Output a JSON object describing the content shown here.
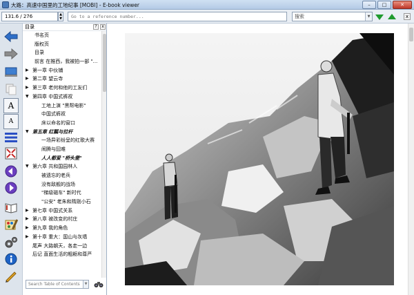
{
  "window": {
    "title": "大路：高速中国里的工地纪事 [MOBI] - E-book viewer",
    "minimize_glyph": "–",
    "maximize_glyph": "□",
    "close_glyph": "✕"
  },
  "toolbar": {
    "position_value": "131.6 / 276",
    "reference_placeholder": "Go to a reference number...",
    "search_placeholder": "搜索",
    "dropdown_glyph": "▼",
    "spin_up": "▲",
    "spin_down": "▼",
    "close_glyph": "x",
    "colors": {
      "nav_arrow": "#1f9a2e"
    }
  },
  "sidebar": {
    "icons": [
      "back-icon",
      "forward-icon",
      "library-icon",
      "copy-icon",
      "font-larger-icon",
      "font-smaller-icon",
      "toc-icon",
      "fullscreen-icon",
      "previous-page-icon",
      "next-page-icon",
      "reference-mode-icon",
      "theme-icon",
      "preferences-icon",
      "info-icon",
      "print-icon"
    ],
    "font_larger_label": "A",
    "font_smaller_label": "A"
  },
  "toc": {
    "header": "目录",
    "header_btn_1": "?",
    "header_btn_2": "x",
    "items": [
      {
        "label": "书名页",
        "indent": 2,
        "arrow": ""
      },
      {
        "label": "版权页",
        "indent": 2,
        "arrow": ""
      },
      {
        "label": "目录",
        "indent": 2,
        "arrow": ""
      },
      {
        "label": "前言 在推西，我被拍一部 \"...",
        "indent": 2,
        "arrow": ""
      },
      {
        "label": "第一章 中伙铺",
        "indent": 1,
        "arrow": "▶"
      },
      {
        "label": "第二章 望云寺",
        "indent": 1,
        "arrow": "▶"
      },
      {
        "label": "第三章 老何和他的工友们",
        "indent": 1,
        "arrow": "▶"
      },
      {
        "label": "第四章 中国式裤衩",
        "indent": 1,
        "arrow": "▼"
      },
      {
        "label": "工地上演 \"黑帮电影\"",
        "indent": 3,
        "arrow": ""
      },
      {
        "label": "中国式裤衩",
        "indent": 3,
        "arrow": ""
      },
      {
        "label": "床以命名的窗口",
        "indent": 3,
        "arrow": ""
      },
      {
        "label": "第五章 红瓢与拉杆",
        "indent": 1,
        "arrow": "▼",
        "bold": true
      },
      {
        "label": "一场异彩纷呈的红歌大赛",
        "indent": 3,
        "arrow": ""
      },
      {
        "label": "闹腾与囧难",
        "indent": 3,
        "arrow": ""
      },
      {
        "label": "人人都爱 \"桥头堡\"",
        "indent": 3,
        "arrow": "",
        "bold": true
      },
      {
        "label": "第六章 共和国园林人",
        "indent": 1,
        "arrow": "▼"
      },
      {
        "label": "被遗忘的老兵",
        "indent": 3,
        "arrow": ""
      },
      {
        "label": "没有敌舰的战场",
        "indent": 3,
        "arrow": ""
      },
      {
        "label": "\"梯级磁车\" 新时代",
        "indent": 3,
        "arrow": ""
      },
      {
        "label": "\"公安\" 老朱和隋刚小石",
        "indent": 3,
        "arrow": ""
      },
      {
        "label": "第七章 中国式关系",
        "indent": 1,
        "arrow": "▶"
      },
      {
        "label": "第八章 被改变的村庄",
        "indent": 1,
        "arrow": "▶"
      },
      {
        "label": "第九章 我的角色",
        "indent": 1,
        "arrow": "▶"
      },
      {
        "label": "第十章 重大：国山与灰墙",
        "indent": 1,
        "arrow": "▶"
      },
      {
        "label": "尾声 大路朝天，各走一边",
        "indent": 1,
        "arrow": ""
      },
      {
        "label": "后记 直面生活的粗粝和尊严",
        "indent": 1,
        "arrow": ""
      }
    ],
    "search_placeholder": "Search Table of Contents",
    "search_dropdown_glyph": "▼"
  }
}
